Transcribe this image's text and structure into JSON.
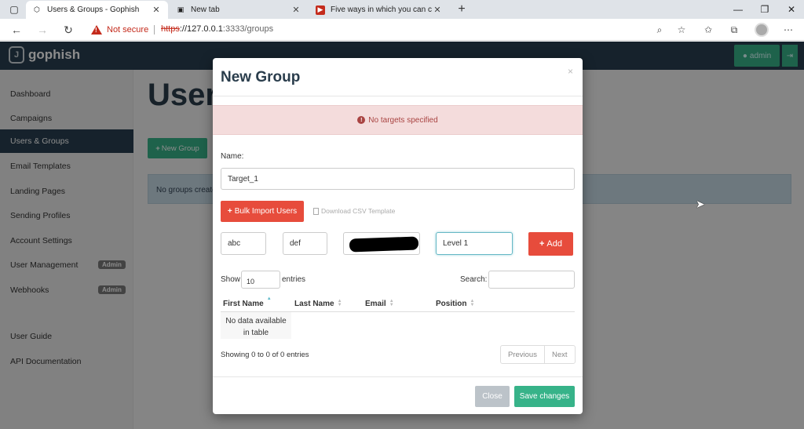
{
  "browser": {
    "tabs": [
      {
        "label": "Users & Groups - Gophish",
        "icon": "shield-icon"
      },
      {
        "label": "New tab",
        "icon": "new-tab-icon"
      },
      {
        "label": "Five ways in which you can comb",
        "icon": "video-icon"
      }
    ],
    "security_text": "Not secure",
    "url_proto": "https",
    "url_rest": "://127.0.0.1",
    "url_path": ":3333/groups"
  },
  "app": {
    "brand": "gophish",
    "admin_label": "admin",
    "page_title": "Users & Groups",
    "new_group_label": "New Group",
    "empty_info": "No groups created yet. Let's create one!",
    "sidebar": {
      "items": [
        {
          "label": "Dashboard"
        },
        {
          "label": "Campaigns"
        },
        {
          "label": "Users & Groups",
          "active": true
        },
        {
          "label": "Email Templates"
        },
        {
          "label": "Landing Pages"
        },
        {
          "label": "Sending Profiles"
        },
        {
          "label": "Account Settings"
        },
        {
          "label": "User Management",
          "badge": "Admin"
        },
        {
          "label": "Webhooks",
          "badge": "Admin"
        }
      ],
      "footer_items": [
        {
          "label": "User Guide"
        },
        {
          "label": "API Documentation"
        }
      ]
    }
  },
  "modal": {
    "title": "New Group",
    "close_glyph": "×",
    "alert_text": "No targets specified",
    "name_label": "Name:",
    "name_value": "Target_1",
    "bulk_import_label": "Bulk Import Users",
    "csv_template_label": "Download CSV Template",
    "first_name_value": "abc",
    "last_name_value": "def",
    "position_value": "Level 1",
    "add_label": "Add",
    "show_label": "Show",
    "show_value": "10",
    "entries_label": "entries",
    "search_label": "Search:",
    "columns": [
      "First Name",
      "Last Name",
      "Email",
      "Position"
    ],
    "empty_line1": "No data available",
    "empty_line2": "in table",
    "info_text": "Showing 0 to 0 of 0 entries",
    "previous_label": "Previous",
    "next_label": "Next",
    "close_label": "Close",
    "save_label": "Save changes"
  },
  "colors": {
    "navbar": "#283f50",
    "accent_green": "#37b389",
    "danger_red": "#e74c3c",
    "alert_bg": "#f4dcdc"
  }
}
